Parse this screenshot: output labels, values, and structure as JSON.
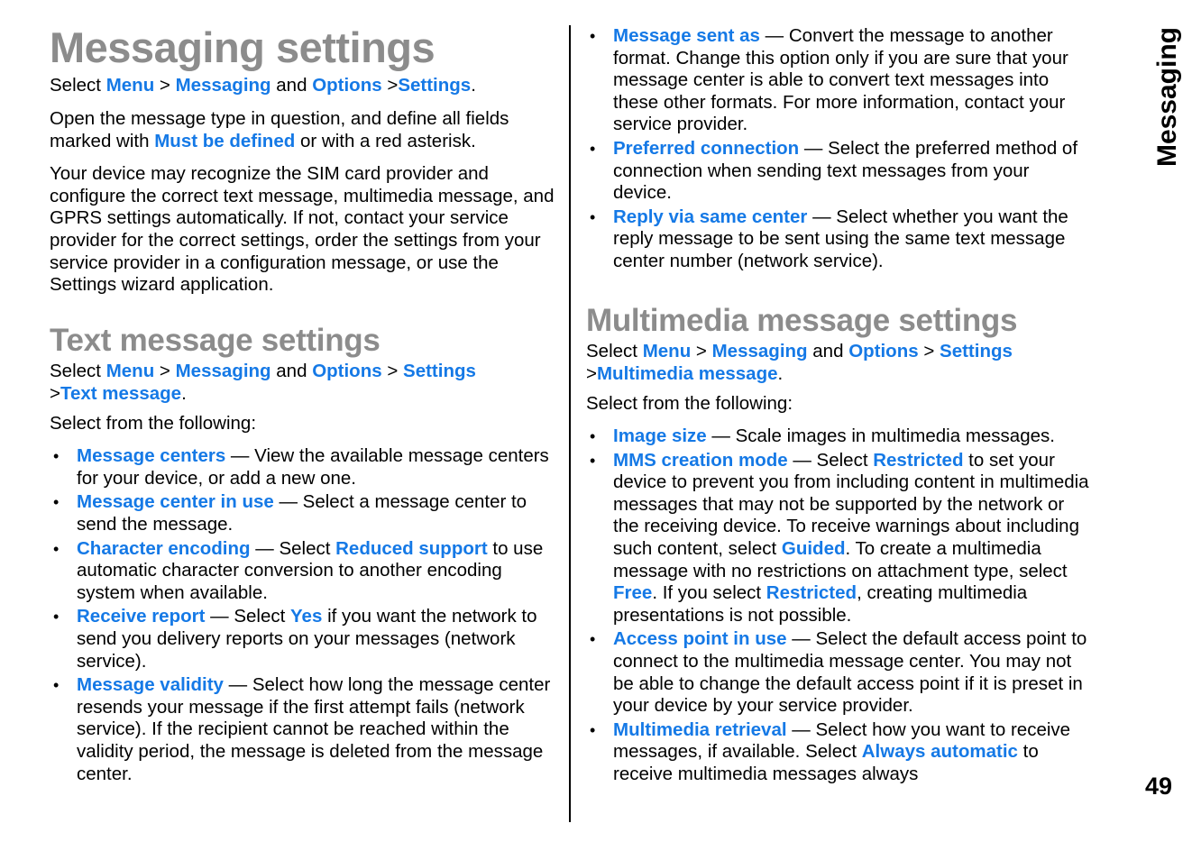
{
  "document": {
    "title": "Messaging settings",
    "side_tab": "Messaging",
    "page_number": "49",
    "accent_blue": "#1579e6",
    "heading_gray": "#8c8c8c"
  },
  "left_column": {
    "intro_path": {
      "select": "Select",
      "menu": "Menu",
      "sep1": ">",
      "messaging": "Messaging",
      "and": "and",
      "options": "Options",
      "sep2": ">",
      "settings": "Settings",
      "period": "."
    },
    "para_open_1": "Open the message type in question, and define all fields marked with ",
    "para_open_must": "Must be defined",
    "para_open_2": " or with a red asterisk.",
    "para_device": "Your device may recognize the SIM card provider and configure the correct text message, multimedia message, and GPRS settings automatically. If not, contact your service provider for the correct settings, order the settings from your service provider in a configuration message, or use the Settings wizard application.",
    "section_title": "Text message settings",
    "section_path": {
      "select": "Select",
      "menu": "Menu",
      "sep1": ">",
      "messaging": "Messaging",
      "and": "and",
      "options": "Options",
      "sep2": ">",
      "settings": "Settings",
      "sep3": ">",
      "text_message": "Text message",
      "period": "."
    },
    "select_following": "Select from the following:",
    "bullets": [
      {
        "term": "Message centers",
        "dash": " — ",
        "desc_1": "View the available message centers for your device, or add a new one.",
        "emph": "",
        "desc_2": ""
      },
      {
        "term": "Message center in use",
        "dash": " — ",
        "desc_1": "Select a message center to send the message.",
        "emph": "",
        "desc_2": ""
      },
      {
        "term": "Character encoding",
        "dash": " — ",
        "desc_1": "Select ",
        "emph": "Reduced support",
        "desc_2": " to use automatic character conversion to another encoding system when available."
      },
      {
        "term": "Receive report",
        "dash": " — ",
        "desc_1": "Select ",
        "emph": "Yes",
        "desc_2": " if you want the network to send you delivery reports on your messages (network service)."
      },
      {
        "term": "Message validity",
        "dash": " — ",
        "desc_1": "Select how long the message center resends your message if the first attempt fails (network service). If the recipient cannot be reached within the validity period, the message is deleted from the message center.",
        "emph": "",
        "desc_2": ""
      }
    ]
  },
  "right_column": {
    "bullets_text_message": [
      {
        "term": "Message sent as",
        "dash": " — ",
        "desc_1": "Convert the message to another format. Change this option only if you are sure that your message center is able to convert text messages into these other formats. For more information, contact your service provider.",
        "emph": "",
        "desc_2": ""
      },
      {
        "term": "Preferred connection",
        "dash": " — ",
        "desc_1": "Select the preferred method of connection when sending text messages from your device.",
        "emph": "",
        "desc_2": ""
      },
      {
        "term": "Reply via same center",
        "dash": " — ",
        "desc_1": "Select whether you want the reply message to be sent using the same text message center number (network service).",
        "emph": "",
        "desc_2": ""
      }
    ],
    "section_title": "Multimedia message settings",
    "section_path": {
      "select": "Select",
      "menu": "Menu",
      "sep1": ">",
      "messaging": "Messaging",
      "and": "and",
      "options": "Options",
      "sep2": ">",
      "settings": "Settings",
      "sep3": ">",
      "multimedia_message": "Multimedia message",
      "period": "."
    },
    "select_following": "Select from the following:",
    "bullets_mms": [
      {
        "term": "Image size",
        "dash": " — ",
        "parts": [
          {
            "kind": "plain",
            "text": "Scale images in multimedia messages."
          }
        ]
      },
      {
        "term": "MMS creation mode",
        "dash": " — ",
        "parts": [
          {
            "kind": "plain",
            "text": "Select "
          },
          {
            "kind": "blue",
            "text": "Restricted"
          },
          {
            "kind": "plain",
            "text": " to set your device to prevent you from including content in multimedia messages that may not be supported by the network or the receiving device. To receive warnings about including such content, select "
          },
          {
            "kind": "blue",
            "text": "Guided"
          },
          {
            "kind": "plain",
            "text": ". To create a multimedia message with no restrictions on attachment type, select "
          },
          {
            "kind": "blue",
            "text": "Free"
          },
          {
            "kind": "plain",
            "text": ". If you select "
          },
          {
            "kind": "blue",
            "text": "Restricted"
          },
          {
            "kind": "plain",
            "text": ", creating multimedia presentations is not possible."
          }
        ]
      },
      {
        "term": "Access point in use",
        "dash": " — ",
        "parts": [
          {
            "kind": "plain",
            "text": "Select the default access point to connect to the multimedia message center. You may not be able to change the default access point if it is preset in your device by your service provider."
          }
        ]
      },
      {
        "term": "Multimedia retrieval",
        "dash": " — ",
        "parts": [
          {
            "kind": "plain",
            "text": "Select how you want to receive messages, if available. Select "
          },
          {
            "kind": "blue",
            "text": "Always automatic"
          },
          {
            "kind": "plain",
            "text": " to receive multimedia messages always"
          }
        ]
      }
    ]
  }
}
